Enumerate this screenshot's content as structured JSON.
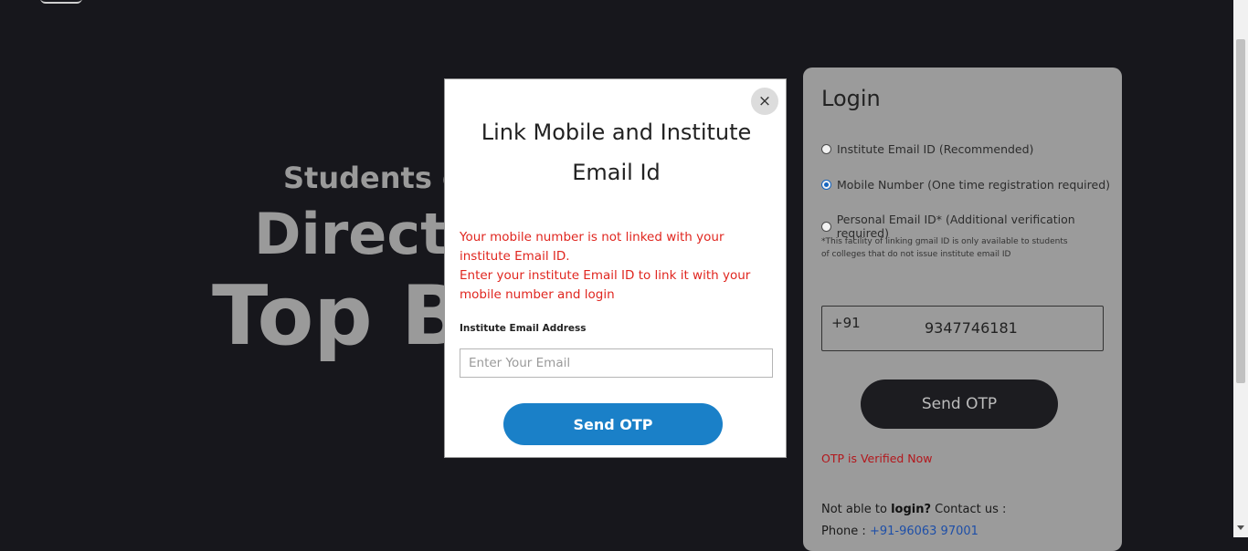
{
  "hero": {
    "line1": "Students ca",
    "line2": "Directly",
    "line3": "Top Br"
  },
  "login": {
    "title": "Login",
    "options": [
      {
        "label": "Institute Email ID (Recommended)",
        "checked": false
      },
      {
        "label": "Mobile Number (One time registration required)",
        "checked": true
      },
      {
        "label": "Personal Email ID* (Additional verification required)",
        "checked": false
      }
    ],
    "note": "*This facility of linking gmail ID is only available to students of colleges that do not issue institute email ID",
    "country_code": "+91",
    "phone_number": "9347746181",
    "send_otp_label": "Send OTP",
    "otp_status": "OTP is Verified Now",
    "contact_prefix": "Not able to",
    "contact_bold": "login?",
    "contact_suffix": "Contact us :",
    "phone_label": "Phone :",
    "phone_link": "+91-96063 97001"
  },
  "modal": {
    "close_icon": "close-icon",
    "close_glyph": "×",
    "title": "Link Mobile and Institute Email Id",
    "message_line1": "Your mobile number is not linked with your institute Email ID.",
    "message_line2": "Enter your institute Email ID to link it with your mobile number and login",
    "field_label": "Institute Email Address",
    "email_placeholder": "Enter Your Email",
    "send_otp_label": "Send OTP"
  },
  "colors": {
    "background": "#17171c",
    "modal_error_text": "#e0261f",
    "modal_button": "#1a80c8",
    "login_card": "#9b9b9b",
    "login_button": "#1c1c20",
    "otp_status": "#b3171c",
    "link": "#1e4fa8"
  }
}
